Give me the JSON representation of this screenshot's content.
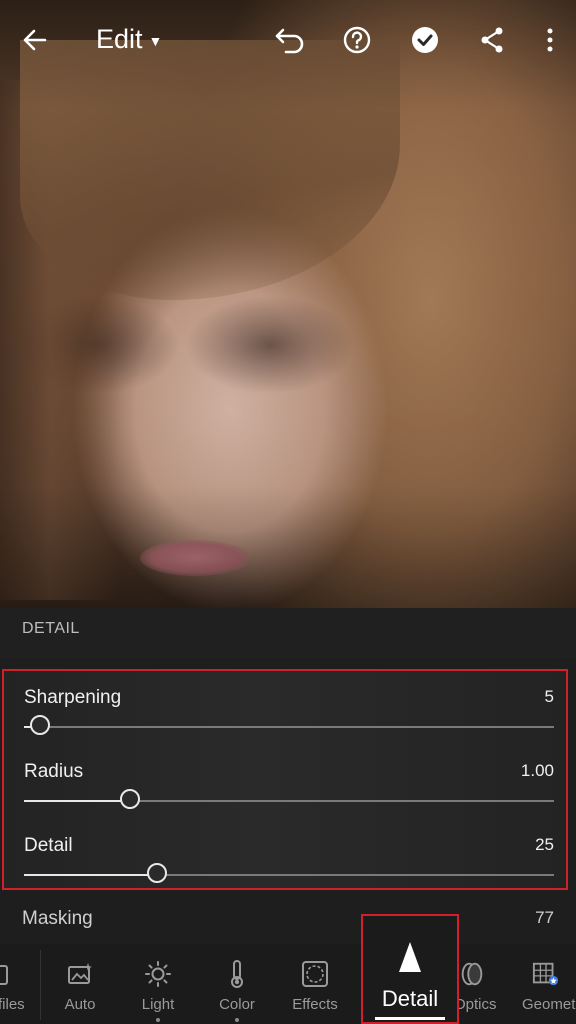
{
  "topbar": {
    "title": "Edit",
    "icons": [
      "back-arrow-icon",
      "chevron-down-icon",
      "undo-icon",
      "help-icon",
      "done-check-icon",
      "share-icon",
      "more-vertical-icon"
    ]
  },
  "panel": {
    "section_title": "DETAIL",
    "sliders": [
      {
        "label": "Sharpening",
        "value": "5",
        "level": 0.03
      },
      {
        "label": "Radius",
        "value": "1.00",
        "level": 0.2
      },
      {
        "label": "Detail",
        "value": "25",
        "level": 0.25
      }
    ],
    "masking": {
      "label": "Masking",
      "value": "77"
    }
  },
  "tabs": {
    "profiles": "files",
    "auto": "Auto",
    "light": "Light",
    "color": "Color",
    "effects": "Effects",
    "detail": "Detail",
    "optics": "Optics",
    "geometry": "Geomet"
  },
  "colors": {
    "highlight": "#d0202a",
    "background": "#1e1e1e",
    "text": "#f0f0f0"
  }
}
